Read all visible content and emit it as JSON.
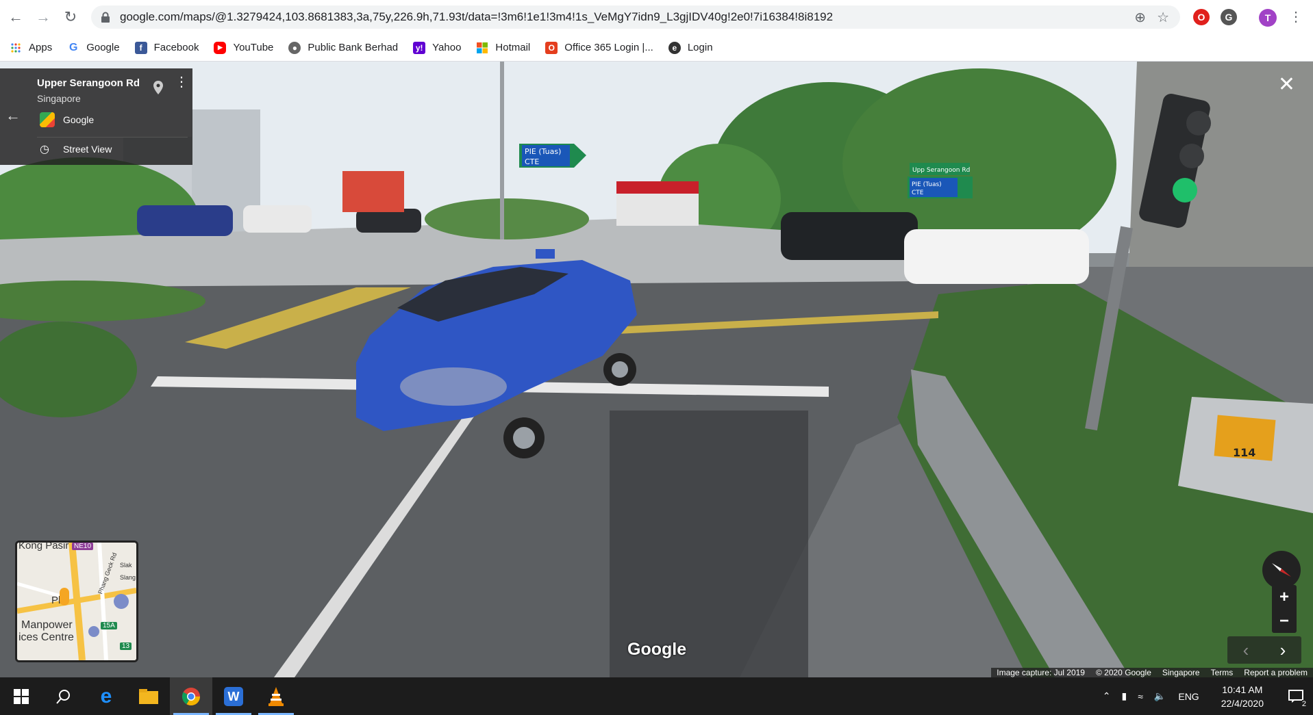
{
  "browser": {
    "url": "google.com/maps/@1.3279424,103.8681383,3a,75y,226.9h,71.93t/data=!3m6!1e1!3m4!1s_VeMgY7idn9_L3gjIDV40g!2e0!7i16384!8i8192",
    "profile_initial": "T",
    "bookmarks": [
      {
        "label": "Apps",
        "icon": "apps-grid-icon"
      },
      {
        "label": "Google",
        "icon": "google-icon"
      },
      {
        "label": "Facebook",
        "icon": "facebook-icon"
      },
      {
        "label": "YouTube",
        "icon": "youtube-icon"
      },
      {
        "label": "Public Bank Berhad",
        "icon": "globe-icon"
      },
      {
        "label": "Yahoo",
        "icon": "yahoo-icon"
      },
      {
        "label": "Hotmail",
        "icon": "microsoft-icon"
      },
      {
        "label": "Office 365 Login |...",
        "icon": "office-icon"
      },
      {
        "label": "Login",
        "icon": "login-icon"
      }
    ]
  },
  "streetview": {
    "location_title": "Upper Serangoon Rd",
    "location_sub": "Singapore",
    "source": "Google",
    "mode_label": "Street View",
    "logo": "Google",
    "signs": {
      "overhead": "PIE (Tuas)",
      "overhead_line2": "CTE",
      "right_top": "Upp Serangoon Rd",
      "right_line1": "PIE (Tuas)",
      "right_line2": "CTE",
      "box_number": "114"
    },
    "minimap": {
      "labels": [
        "Kong Pasir",
        "NE10",
        "Manpower",
        "ices Centre",
        "15A",
        "13",
        "Phang Geck Rd",
        "Slak",
        "Slang",
        "Pl"
      ]
    },
    "footer": [
      "Image capture: Jul 2019",
      "© 2020 Google",
      "Singapore",
      "Terms",
      "Report a problem"
    ]
  },
  "taskbar": {
    "time": "10:41 AM",
    "date": "22/4/2020",
    "lang": "ENG",
    "notifications": "2"
  },
  "colors": {
    "taxi_blue": "#2f56c4",
    "sky": "#dfe7ee",
    "tree": "#3f7a3a",
    "sign_green": "#1f8a4e"
  }
}
